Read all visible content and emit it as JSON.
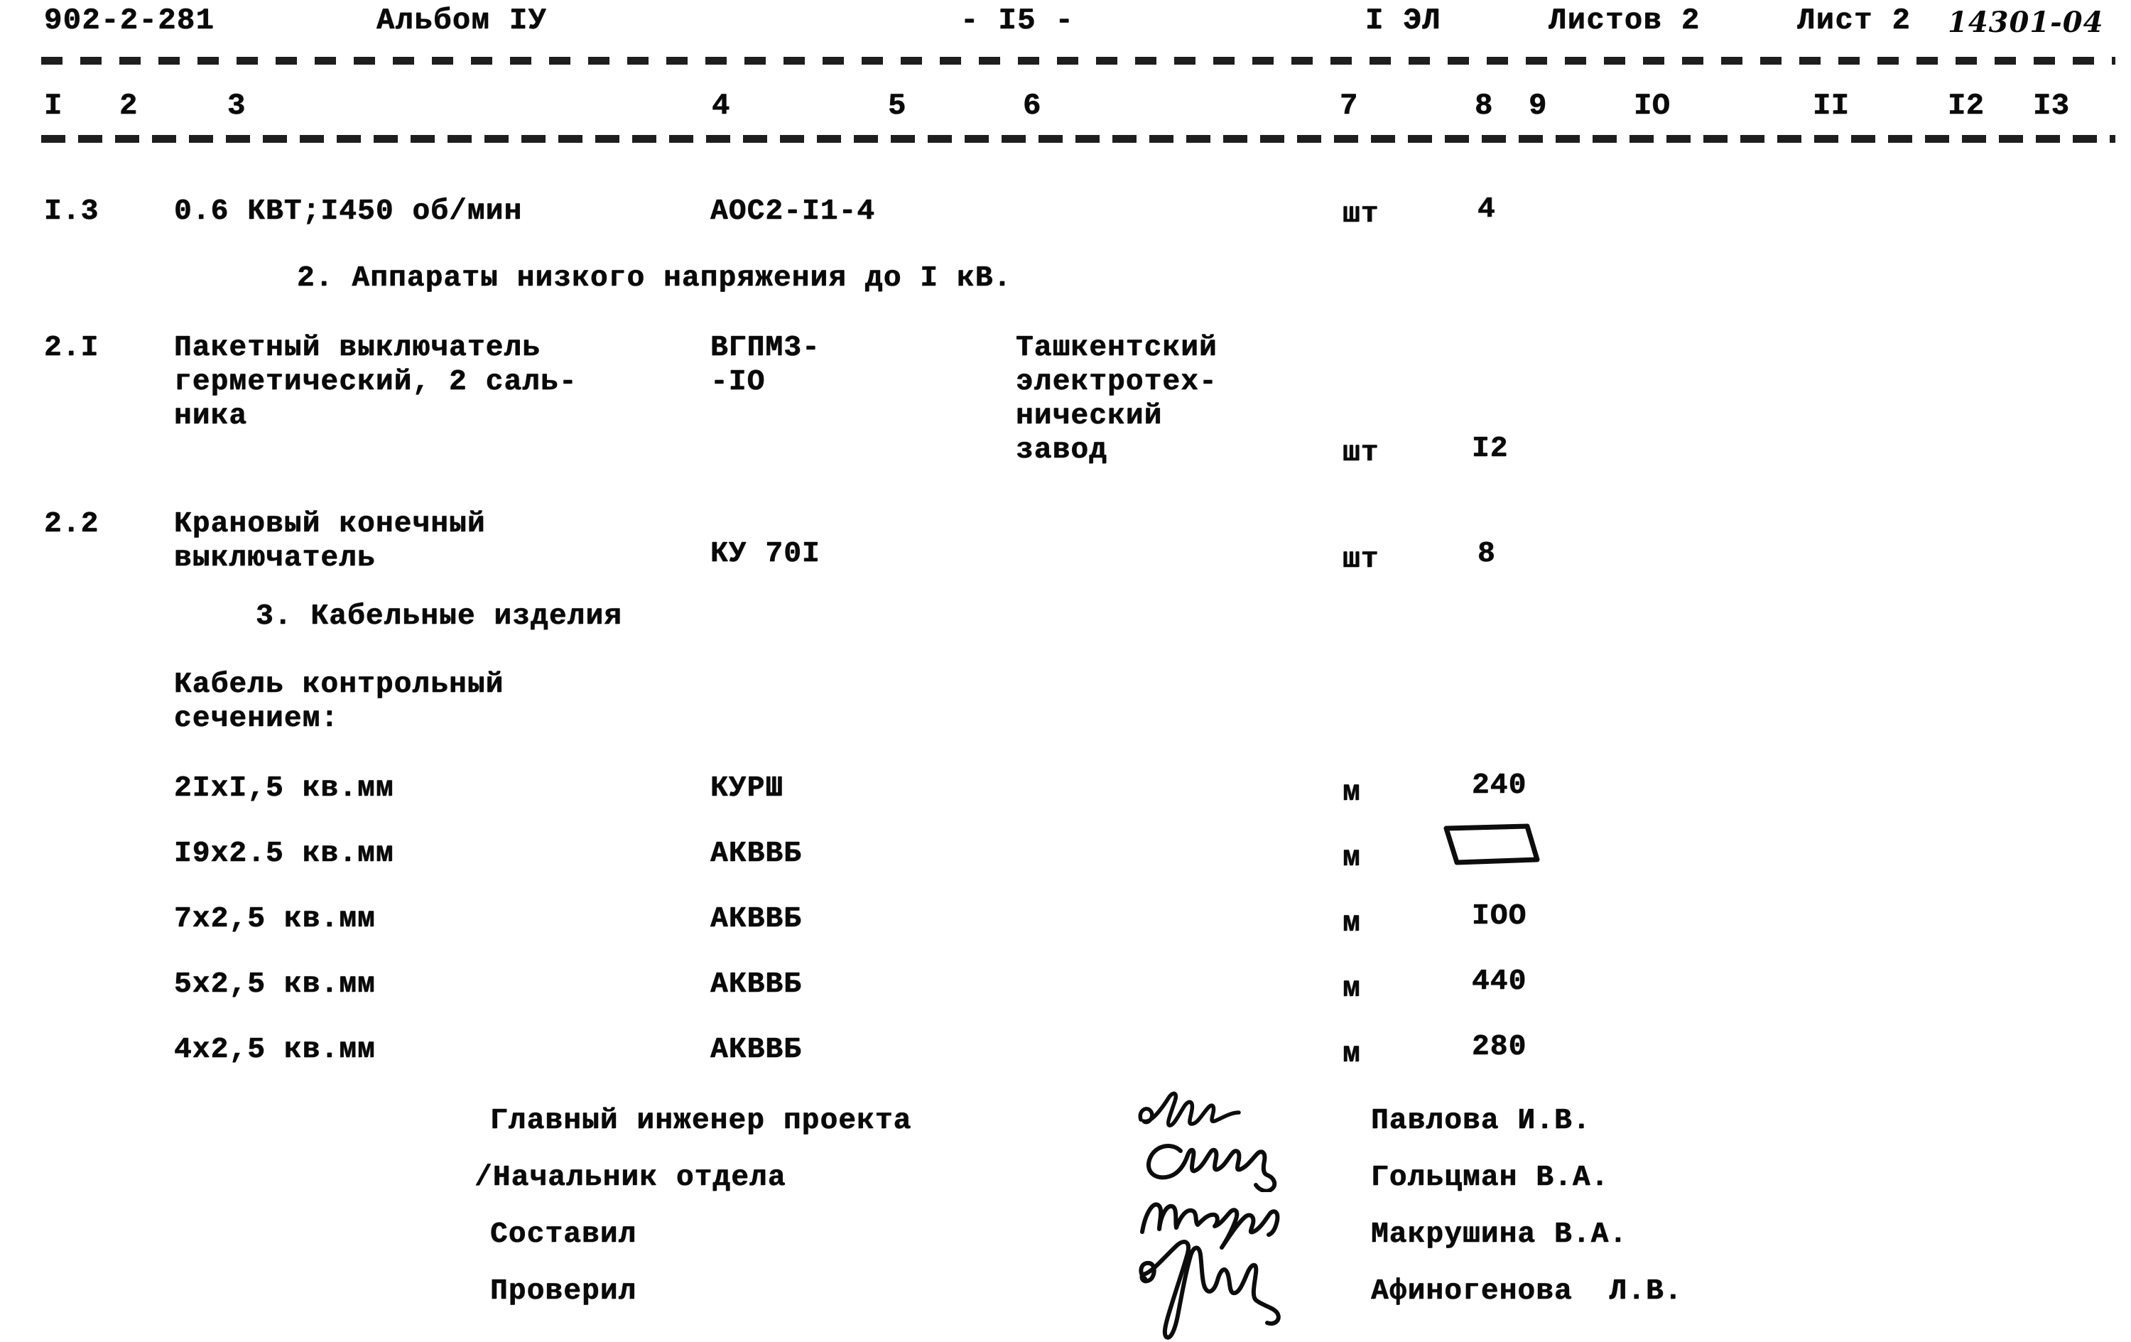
{
  "document": {
    "series_code": "902-2-281",
    "album": "Альбом IУ",
    "page_marker": "- I5 -",
    "sheet_type": "I ЭЛ",
    "sheets_total": "Листов 2",
    "sheet_number": "Лист 2",
    "handwritten_code": "14301-04"
  },
  "column_headers": {
    "left": [
      "I",
      "2",
      "3",
      "4",
      "5",
      "6"
    ],
    "right": [
      "7",
      "8",
      "9",
      "IO",
      "II",
      "I2",
      "I3"
    ]
  },
  "rows": [
    {
      "pos": "I.3",
      "name": "0.6 КВТ;I450 об/мин",
      "type": "АОС2-I1-4",
      "maker": "",
      "unit": "шт",
      "qty": "4"
    },
    {
      "pos": "2.I",
      "name_lines": [
        "Пакетный выключатель",
        "герметический, 2 саль-",
        "ника"
      ],
      "type_lines": [
        "ВГПМ3-",
        "-IO"
      ],
      "maker_lines": [
        "Ташкентский",
        "электротех-",
        "нический",
        "завод"
      ],
      "unit": "шт",
      "qty": "I2"
    },
    {
      "pos": "2.2",
      "name_lines": [
        "Крановый конечный",
        "выключатель"
      ],
      "type": "КУ 70I",
      "maker": "",
      "unit": "шт",
      "qty": "8"
    }
  ],
  "sections": [
    {
      "id": "sec2",
      "title": "2. Аппараты низкого напряжения до I кВ."
    },
    {
      "id": "sec3",
      "title": "3. Кабельные изделия"
    }
  ],
  "cable_block": {
    "intro_lines": [
      "Кабель контрольный",
      "сечением:"
    ],
    "items": [
      {
        "section": "2IxI,5 кв.мм",
        "brand": "КУРШ",
        "unit": "м",
        "qty": "240"
      },
      {
        "section": "I9x2.5 кв.мм",
        "brand": "АКВВБ",
        "unit": "м",
        "qty": ""
      },
      {
        "section": "7x2,5 кв.мм",
        "brand": "АКВВБ",
        "unit": "м",
        "qty": "IOO"
      },
      {
        "section": "5x2,5 кв.мм",
        "brand": "АКВВБ",
        "unit": "м",
        "qty": "440"
      },
      {
        "section": "4x2,5 кв.мм",
        "brand": "АКВВБ",
        "unit": "м",
        "qty": "280"
      }
    ]
  },
  "signatures": [
    {
      "role": "Главный инженер проекта",
      "name": "Павлова И.В."
    },
    {
      "role": "/Начальник отдела",
      "name": "Гольцман В.А."
    },
    {
      "role": "Составил",
      "name": "Макрушина В.А."
    },
    {
      "role": "Проверил",
      "name": "Афиногенова  Л.В."
    }
  ],
  "ink_color": "#0d0d0d",
  "paper_color": "#ffffff"
}
